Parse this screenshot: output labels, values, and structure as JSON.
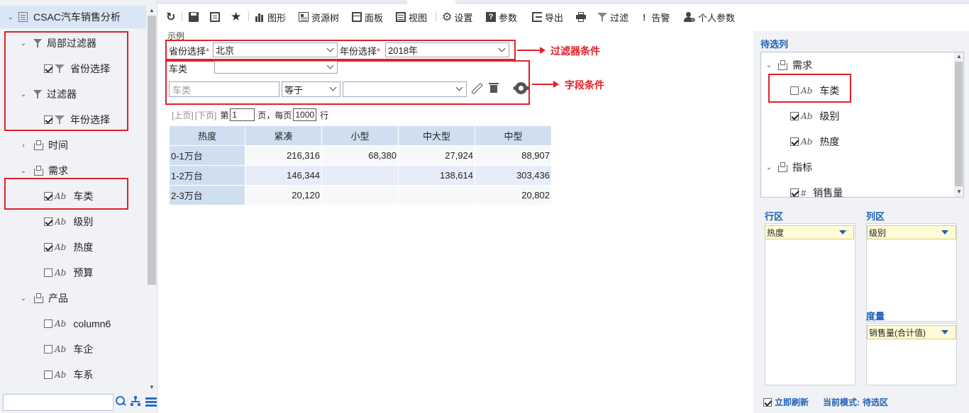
{
  "left_tree": {
    "root": "CSAC汽车销售分析",
    "items": [
      {
        "label": "局部过滤器",
        "kind": "filter-group",
        "state": "expanded"
      },
      {
        "label": "省份选择",
        "kind": "filter",
        "checked": true
      },
      {
        "label": "过滤器",
        "kind": "filter-group",
        "state": "expanded"
      },
      {
        "label": "年份选择",
        "kind": "filter",
        "checked": true
      },
      {
        "label": "时间",
        "kind": "folder",
        "state": "collapsed"
      },
      {
        "label": "需求",
        "kind": "folder",
        "state": "expanded"
      },
      {
        "label": "车类",
        "kind": "field",
        "checked": true
      },
      {
        "label": "级别",
        "kind": "field",
        "checked": true
      },
      {
        "label": "热度",
        "kind": "field",
        "checked": true
      },
      {
        "label": "预算",
        "kind": "field",
        "checked": false
      },
      {
        "label": "产品",
        "kind": "folder",
        "state": "expanded"
      },
      {
        "label": "column6",
        "kind": "field",
        "checked": false
      },
      {
        "label": "车企",
        "kind": "field",
        "checked": false
      },
      {
        "label": "车系",
        "kind": "field",
        "checked": false
      }
    ],
    "search_value": ""
  },
  "toolbar": {
    "buttons": [
      "图形",
      "资源树",
      "面板",
      "视图",
      "设置",
      "参数",
      "导出",
      "过滤",
      "告警",
      "个人参数"
    ],
    "icons": [
      "refresh-icon",
      "save-icon",
      "save-as-icon",
      "star-icon"
    ]
  },
  "main": {
    "caption": "示例",
    "filters": {
      "province_label": "省份选择",
      "province_value": "北京",
      "year_label": "年份选择",
      "year_value": "2018年",
      "required_mark": "*"
    },
    "field_condition": {
      "field_label": "车类",
      "field_select_value": "",
      "text_placeholder": "车类",
      "operator": "等于",
      "value": ""
    },
    "annotations": {
      "filter_note": "过滤器条件",
      "field_note": "字段条件"
    },
    "pager": {
      "prev": "[上页]",
      "next": "[下页]",
      "page_prefix": "第",
      "page": "1",
      "page_suffix": "页，每页",
      "page_size": "1000",
      "rows_suffix": "行"
    },
    "table": {
      "columns": [
        "热度",
        "紧凑",
        "小型",
        "中大型",
        "中型"
      ],
      "rows": [
        [
          "0-1万台",
          "216,316",
          "68,380",
          "27,924",
          "88,907"
        ],
        [
          "1-2万台",
          "146,344",
          "",
          "138,614",
          "303,436"
        ],
        [
          "2-3万台",
          "20,120",
          "",
          "",
          "20,802"
        ]
      ]
    }
  },
  "right_panel": {
    "candidates_title": "待选列",
    "candidates": [
      {
        "label": "需求",
        "kind": "folder"
      },
      {
        "label": "车类",
        "kind": "field",
        "checked": false
      },
      {
        "label": "级别",
        "kind": "field",
        "checked": true
      },
      {
        "label": "热度",
        "kind": "field",
        "checked": true
      },
      {
        "label": "指标",
        "kind": "folder"
      },
      {
        "label": "销售量",
        "kind": "measure",
        "checked": true
      }
    ],
    "row_zone_title": "行区",
    "row_zone_value": "热度",
    "col_zone_title": "列区",
    "col_zone_value": "级别",
    "measure_title": "度量",
    "measure_value": "销售量(合计值)",
    "refresh_label": "立即刷新",
    "refresh_checked": true,
    "mode_label": "当前模式:",
    "mode_value": "待选区"
  },
  "colors": {
    "accent_red": "#e0212a",
    "link_blue": "#1f5fb5",
    "header_blue": "#d0dff0",
    "zone_yellow": "#fffbd6"
  }
}
